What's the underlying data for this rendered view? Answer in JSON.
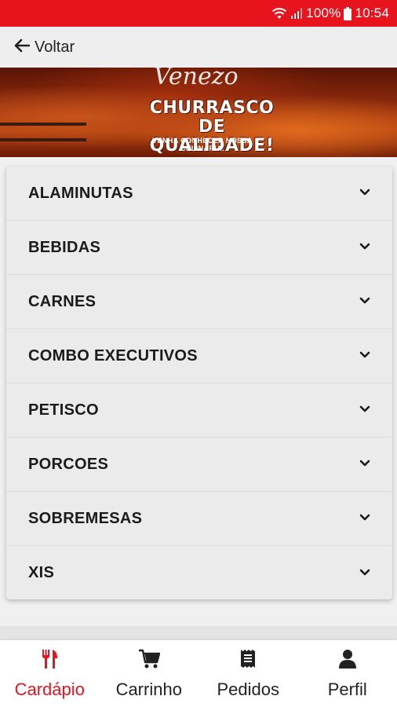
{
  "status_bar": {
    "battery": "100%",
    "time": "10:54",
    "icons": [
      "wifi-icon",
      "signal-icon",
      "battery-icon"
    ]
  },
  "topbar": {
    "back_label": "Voltar"
  },
  "banner": {
    "logo": "Venezo",
    "headline_line1": "CHURRASCO",
    "headline_line2": "DE QUALIDADE!",
    "subline": "VENHA CONHECER NOSSA CULINÁRIA."
  },
  "menu": {
    "items": [
      {
        "label": "ALAMINUTAS",
        "icon": "chevron-down-icon"
      },
      {
        "label": "BEBIDAS",
        "icon": "chevron-down-icon"
      },
      {
        "label": "CARNES",
        "icon": "chevron-down-icon"
      },
      {
        "label": "COMBO EXECUTIVOS",
        "icon": "chevron-down-icon"
      },
      {
        "label": "PETISCO",
        "icon": "chevron-down-icon"
      },
      {
        "label": "PORCOES",
        "icon": "chevron-down-icon"
      },
      {
        "label": "SOBREMESAS",
        "icon": "chevron-down-icon"
      },
      {
        "label": "XIS",
        "icon": "chevron-down-icon"
      }
    ]
  },
  "bottom_nav": {
    "items": [
      {
        "label": "Cardápio",
        "icon": "cutlery-icon",
        "active": true
      },
      {
        "label": "Carrinho",
        "icon": "cart-icon",
        "active": false
      },
      {
        "label": "Pedidos",
        "icon": "receipt-icon",
        "active": false
      },
      {
        "label": "Perfil",
        "icon": "user-icon",
        "active": false
      }
    ]
  },
  "colors": {
    "accent": "#e8141d",
    "text": "#1b1b1b",
    "card_bg": "#ebebeb"
  }
}
